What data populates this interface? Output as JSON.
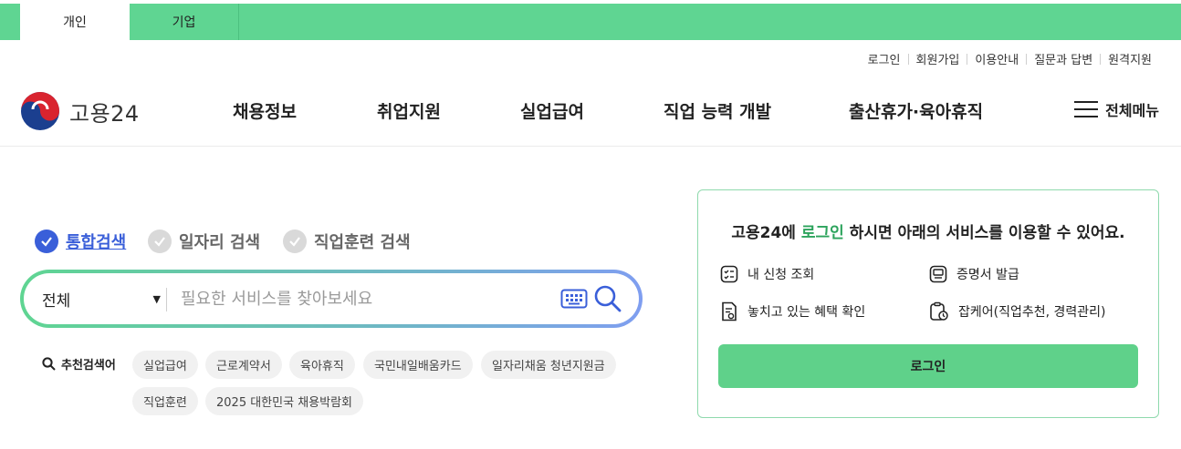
{
  "top_tabs": [
    "개인",
    "기업"
  ],
  "utility_links": [
    "로그인",
    "회원가입",
    "이용안내",
    "질문과 답변",
    "원격지원"
  ],
  "logo": {
    "text": "고용24",
    "icon": "taegeuk-logo-icon"
  },
  "gnb": [
    "채용정보",
    "취업지원",
    "실업급여",
    "직업 능력 개발",
    "출산휴가·육아휴직"
  ],
  "all_menu": {
    "label": "전체메뉴",
    "icon": "hamburger-icon"
  },
  "search": {
    "types": [
      "통합검색",
      "일자리 검색",
      "직업훈련 검색"
    ],
    "selected_type": "통합검색",
    "scope": "전체",
    "placeholder": "필요한 서비스를 찾아보세요",
    "keyboard_icon": "keyboard-icon",
    "search_icon": "search-icon"
  },
  "recommended": {
    "label": "추천검색어",
    "keywords": [
      "실업급여",
      "근로계약서",
      "육아휴직",
      "국민내일배움카드",
      "일자리채움 청년지원금",
      "직업훈련",
      "2025 대한민국 채용박람회"
    ]
  },
  "login_panel": {
    "msg_prefix": "고용24에 ",
    "msg_highlight": "로그인",
    "msg_suffix": " 하시면 아래의 서비스를 이용할 수 있어요.",
    "services": [
      "내 신청 조회",
      "증명서 발급",
      "놓치고 있는 혜택 확인",
      "잡케어(직업추천, 경력관리)"
    ],
    "button": "로그인"
  },
  "colors": {
    "brand_green": "#5fd592",
    "accent_blue": "#3a5fd9",
    "highlight_green": "#2ca35c"
  }
}
